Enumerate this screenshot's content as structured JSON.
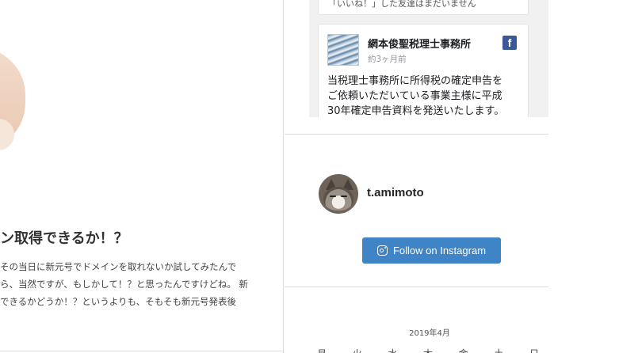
{
  "article": {
    "title": "ン取得できるか！？",
    "lines": [
      "その当日に新元号でドメインを取れないか試してみたんで",
      "ら、当然ですが、もしかして！？と思ったんですけどね。 新",
      "できるかどうか！？というよりも、そもそも新元号発表後"
    ]
  },
  "facebook": {
    "prev_card_text": "「いいね！」した友達はまだいません",
    "page_name": "網本俊聖税理士事務所",
    "time": "約3ヶ月前",
    "post_lines": [
      "当税理士事務所に所得税の確定申告を",
      "ご依頼いただいている事業主様に平成",
      "30年確定申告資料を発送いたします。"
    ],
    "logo": "f"
  },
  "instagram": {
    "username": "t.amimoto",
    "follow_label": "Follow on Instagram"
  },
  "calendar": {
    "caption": "2019年4月",
    "weekdays": [
      "月",
      "火",
      "水",
      "木",
      "金",
      "土",
      "日"
    ]
  },
  "colors": {
    "instagram_button": "#3f84c6",
    "facebook_blue": "#3b5998"
  }
}
